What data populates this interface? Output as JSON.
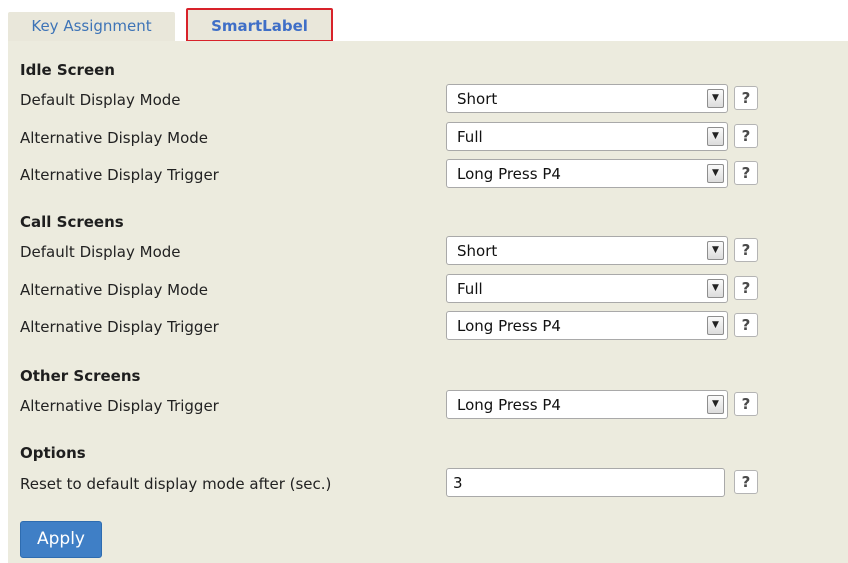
{
  "tabs": [
    {
      "label": "Key Assignment"
    },
    {
      "label": "SmartLabel"
    }
  ],
  "sections": [
    {
      "title": "Idle Screen",
      "rows": [
        {
          "label": "Default Display Mode",
          "value": "Short"
        },
        {
          "label": "Alternative Display Mode",
          "value": "Full"
        },
        {
          "label": "Alternative Display Trigger",
          "value": "Long Press P4"
        }
      ]
    },
    {
      "title": "Call Screens",
      "rows": [
        {
          "label": "Default Display Mode",
          "value": "Short"
        },
        {
          "label": "Alternative Display Mode",
          "value": "Full"
        },
        {
          "label": "Alternative Display Trigger",
          "value": "Long Press P4"
        }
      ]
    },
    {
      "title": "Other Screens",
      "rows": [
        {
          "label": "Alternative Display Trigger",
          "value": "Long Press P4"
        }
      ]
    },
    {
      "title": "Options",
      "rows": [
        {
          "label": "Reset to default display mode after (sec.)",
          "value": "3"
        }
      ]
    }
  ],
  "help_glyph": "?",
  "dropdown_glyph": "▼",
  "apply_label": "Apply",
  "colors": {
    "panel_bg": "#ecebde",
    "tab_text": "#3e74b7",
    "active_tab_border": "#d8222a",
    "apply_bg": "#3f7fc6"
  }
}
